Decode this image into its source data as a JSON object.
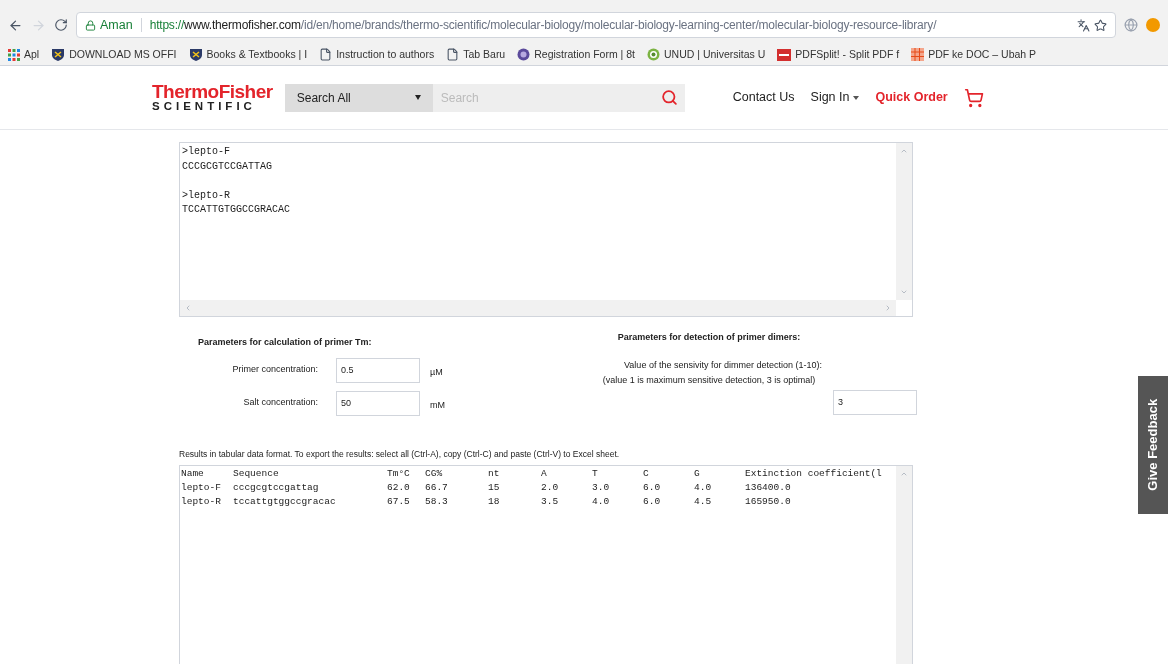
{
  "browser": {
    "security": "Aman",
    "url_host": "https://www.thermofisher.com",
    "url_path": "/id/en/home/brands/thermo-scientific/molecular-biology/molecular-biology-learning-center/molecular-biology-resource-library/",
    "bookmarks": [
      {
        "label": "Apl",
        "kind": "apps"
      },
      {
        "label": "DOWNLOAD MS OFFI",
        "kind": "shield"
      },
      {
        "label": "Books & Textbooks | I",
        "kind": "shield"
      },
      {
        "label": "Instruction to authors",
        "kind": "page"
      },
      {
        "label": "Tab Baru",
        "kind": "page"
      },
      {
        "label": "Registration Form | 8t",
        "kind": "circle"
      },
      {
        "label": "UNUD | Universitas U",
        "kind": "ring"
      },
      {
        "label": "PDFSplit! - Split PDF f",
        "kind": "pdf"
      },
      {
        "label": "PDF ke DOC – Ubah P",
        "kind": "grid"
      }
    ]
  },
  "header": {
    "logo_top": "ThermoFisher",
    "logo_bottom": "SCIENTIFIC",
    "search_scope": "Search All",
    "search_placeholder": "Search",
    "links": [
      "Contact Us",
      "Sign In"
    ],
    "quick_order": "Quick Order"
  },
  "input": {
    "value": ">lepto-F\nCCCGCGTCCGATTAG\n\n>lepto-R\nTCCATTGTGGCCGRACAC"
  },
  "tm_params": {
    "title": "Parameters for calculation of primer Tm:",
    "fields": [
      {
        "label": "Primer concentration:",
        "value": "0.5",
        "unit": "µM"
      },
      {
        "label": "Salt concentration:",
        "value": "50",
        "unit": "mM"
      }
    ]
  },
  "dimer_params": {
    "title": "Parameters for detection of primer dimers:",
    "line_1": "Value of the sensivity for dimmer detection (1-10):",
    "line_2": "(value 1 is maximum sensitive detection, 3 is optimal)",
    "value": "3"
  },
  "results": {
    "note": "Results in tabular data format. To export the results: select all (Ctrl-A), copy (Ctrl-C) and paste (Ctrl-V) to Excel sheet.",
    "columns": [
      "Name",
      "Sequence",
      "Tm°C",
      "CG%",
      "nt",
      "A",
      "T",
      "C",
      "G",
      "Extinction coefficient(l"
    ],
    "rows": [
      [
        "lepto-F",
        "cccgcgtccgattag",
        "62.0",
        "66.7",
        "15",
        "2.0",
        "3.0",
        "6.0",
        "4.0",
        "136400.0"
      ],
      [
        "lepto-R",
        "tccattgtggccgracac",
        "67.5",
        "58.3",
        "18",
        "3.5",
        "4.0",
        "6.0",
        "4.5",
        "165950.0"
      ]
    ]
  },
  "feedback": "Give Feedback"
}
